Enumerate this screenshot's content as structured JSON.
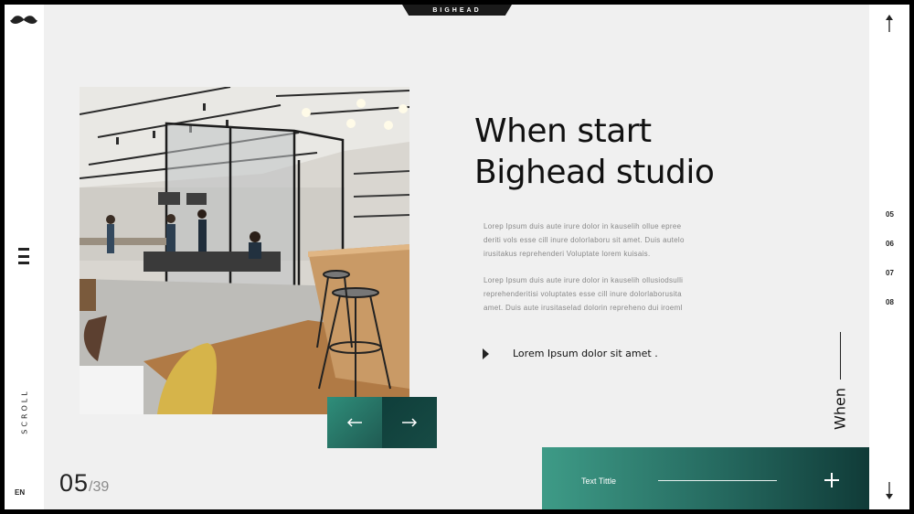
{
  "brand": {
    "name": "BIGHEAD"
  },
  "left_rail": {
    "scroll_label": "SCROLL",
    "lang": "EN"
  },
  "hero": {
    "title_line1": "When start",
    "title_line2": "Bighead studio",
    "paragraph1": [
      "Lorep  Ipsum duis aute irure dolor in kauselih ollue epree",
      "deriti vols esse cill inure dolorlaboru  sit amet. Duis autelo",
      "irusitakus  reprehenderi  Voluptate lorem kuisais."
    ],
    "paragraph2": [
      "Lorep  Ipsum duis aute irure dolor in kauselih ollusiodsulli",
      "reprehenderitisi  voluptates esse cill inure dolorlaborusita",
      "amet. Duis aute irusitaselad  dolorin repreheno dui iroeml"
    ],
    "bullet_text": "Lorem Ipsum dolor sit amet ."
  },
  "side_label": "When",
  "cta": {
    "label": "Text Tittle"
  },
  "pagination": {
    "current": "05",
    "total": "/39"
  },
  "slides": [
    "05",
    "06",
    "07",
    "08"
  ],
  "icons": {
    "logo": "mustache-icon",
    "menu": "hamburger-icon",
    "prev": "arrow-left-icon",
    "next": "arrow-right-icon",
    "up": "arrow-up-icon",
    "down": "arrow-down-icon",
    "bullet": "triangle-right-icon",
    "cta": "plus-icon"
  },
  "colors": {
    "accent_teal": "#3e9b87",
    "accent_dark": "#103b38",
    "panel_bg": "#f0f0f0",
    "text_dark": "#111111"
  }
}
